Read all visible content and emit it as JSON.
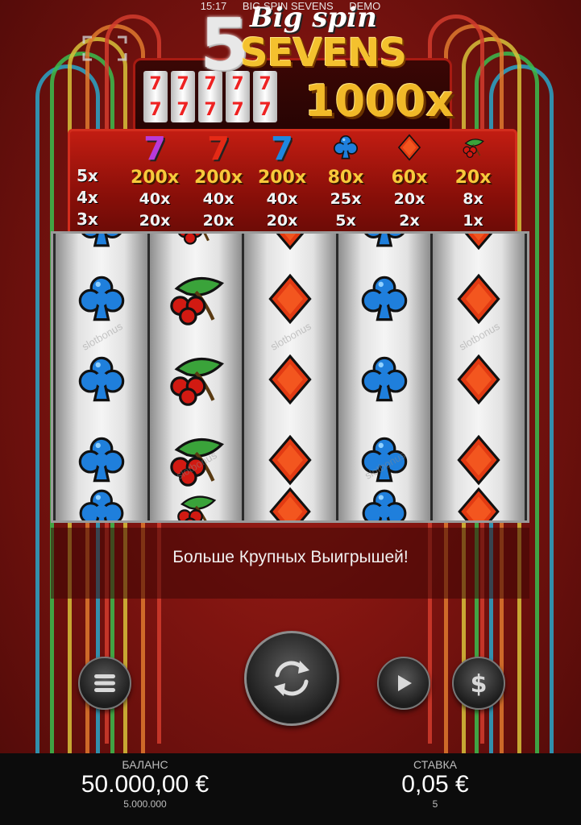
{
  "status": {
    "time": "15:17",
    "title": "BIG SPIN SEVENS",
    "mode": "DEMO"
  },
  "logo": {
    "number": "5",
    "line1": "Big spin",
    "line2": "SEVENS",
    "multiplier": "1000x",
    "mini_reel_symbol": "7"
  },
  "paytable": {
    "row_labels": [
      "5x",
      "4x",
      "3x"
    ],
    "columns": [
      {
        "symbol": "purple-seven",
        "glyph": "7",
        "color": "#b83ad9",
        "x5": "200x",
        "x4": "40x",
        "x3": "20x"
      },
      {
        "symbol": "red-seven",
        "glyph": "7",
        "color": "#e52a16",
        "x5": "200x",
        "x4": "40x",
        "x3": "20x"
      },
      {
        "symbol": "blue-seven",
        "glyph": "7",
        "color": "#1e88e0",
        "x5": "200x",
        "x4": "40x",
        "x3": "20x"
      },
      {
        "symbol": "club",
        "glyph": "♣",
        "color": "#1e7fdc",
        "x5": "80x",
        "x4": "25x",
        "x3": "5x"
      },
      {
        "symbol": "diamond",
        "glyph": "♦",
        "color": "#e53512",
        "x5": "60x",
        "x4": "20x",
        "x3": "2x"
      },
      {
        "symbol": "cherry",
        "glyph": "cherry",
        "color": "#cc1a10",
        "x5": "20x",
        "x4": "8x",
        "x3": "1x"
      }
    ]
  },
  "reels": [
    [
      "club",
      "club",
      "club"
    ],
    [
      "cherry",
      "cherry",
      "cherry"
    ],
    [
      "diamond",
      "diamond",
      "diamond"
    ],
    [
      "club",
      "club",
      "club"
    ],
    [
      "diamond",
      "diamond",
      "diamond"
    ]
  ],
  "watermark": "slotbonus",
  "tagline": "Больше Крупных Выигрышей!",
  "controls": {
    "menu_icon": "menu-icon",
    "spin_icon": "spin-icon",
    "autoplay_icon": "play-icon",
    "bet_icon": "dollar-icon"
  },
  "balance": {
    "label": "БАЛАНС",
    "value": "50.000,00 €",
    "credits": "5.000.000"
  },
  "bet": {
    "label": "СТАВКА",
    "value": "0,05 €",
    "credits": "5"
  }
}
